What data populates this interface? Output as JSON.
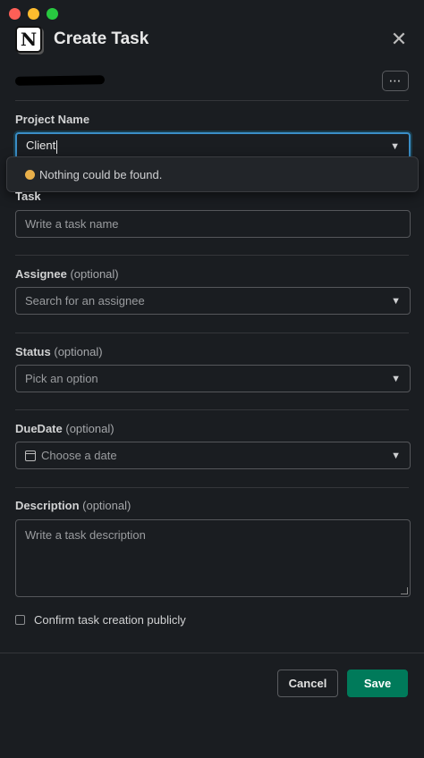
{
  "window": {
    "title": "Create Task",
    "app_icon": "notion-logo",
    "close_icon": "close-icon",
    "more_label": "⋯"
  },
  "form": {
    "project": {
      "label": "Project Name",
      "value": "Client"
    },
    "dropdown": {
      "message": "Nothing could be found.",
      "emoji": "disappointed-face-emoji"
    },
    "task": {
      "label": "Task",
      "placeholder": "Write a task name"
    },
    "assignee": {
      "label": "Assignee",
      "optional": "(optional)",
      "placeholder": "Search for an assignee"
    },
    "status": {
      "label": "Status",
      "optional": "(optional)",
      "placeholder": "Pick an option"
    },
    "due_date": {
      "label": "DueDate",
      "optional": "(optional)",
      "placeholder": "Choose a date"
    },
    "description": {
      "label": "Description",
      "optional": "(optional)",
      "placeholder": "Write a task description"
    },
    "confirm": {
      "label": "Confirm task creation publicly",
      "checked": false
    }
  },
  "footer": {
    "cancel_label": "Cancel",
    "save_label": "Save"
  },
  "colors": {
    "background": "#1a1d21",
    "focus": "#1d9bd1",
    "save": "#007a5a"
  }
}
